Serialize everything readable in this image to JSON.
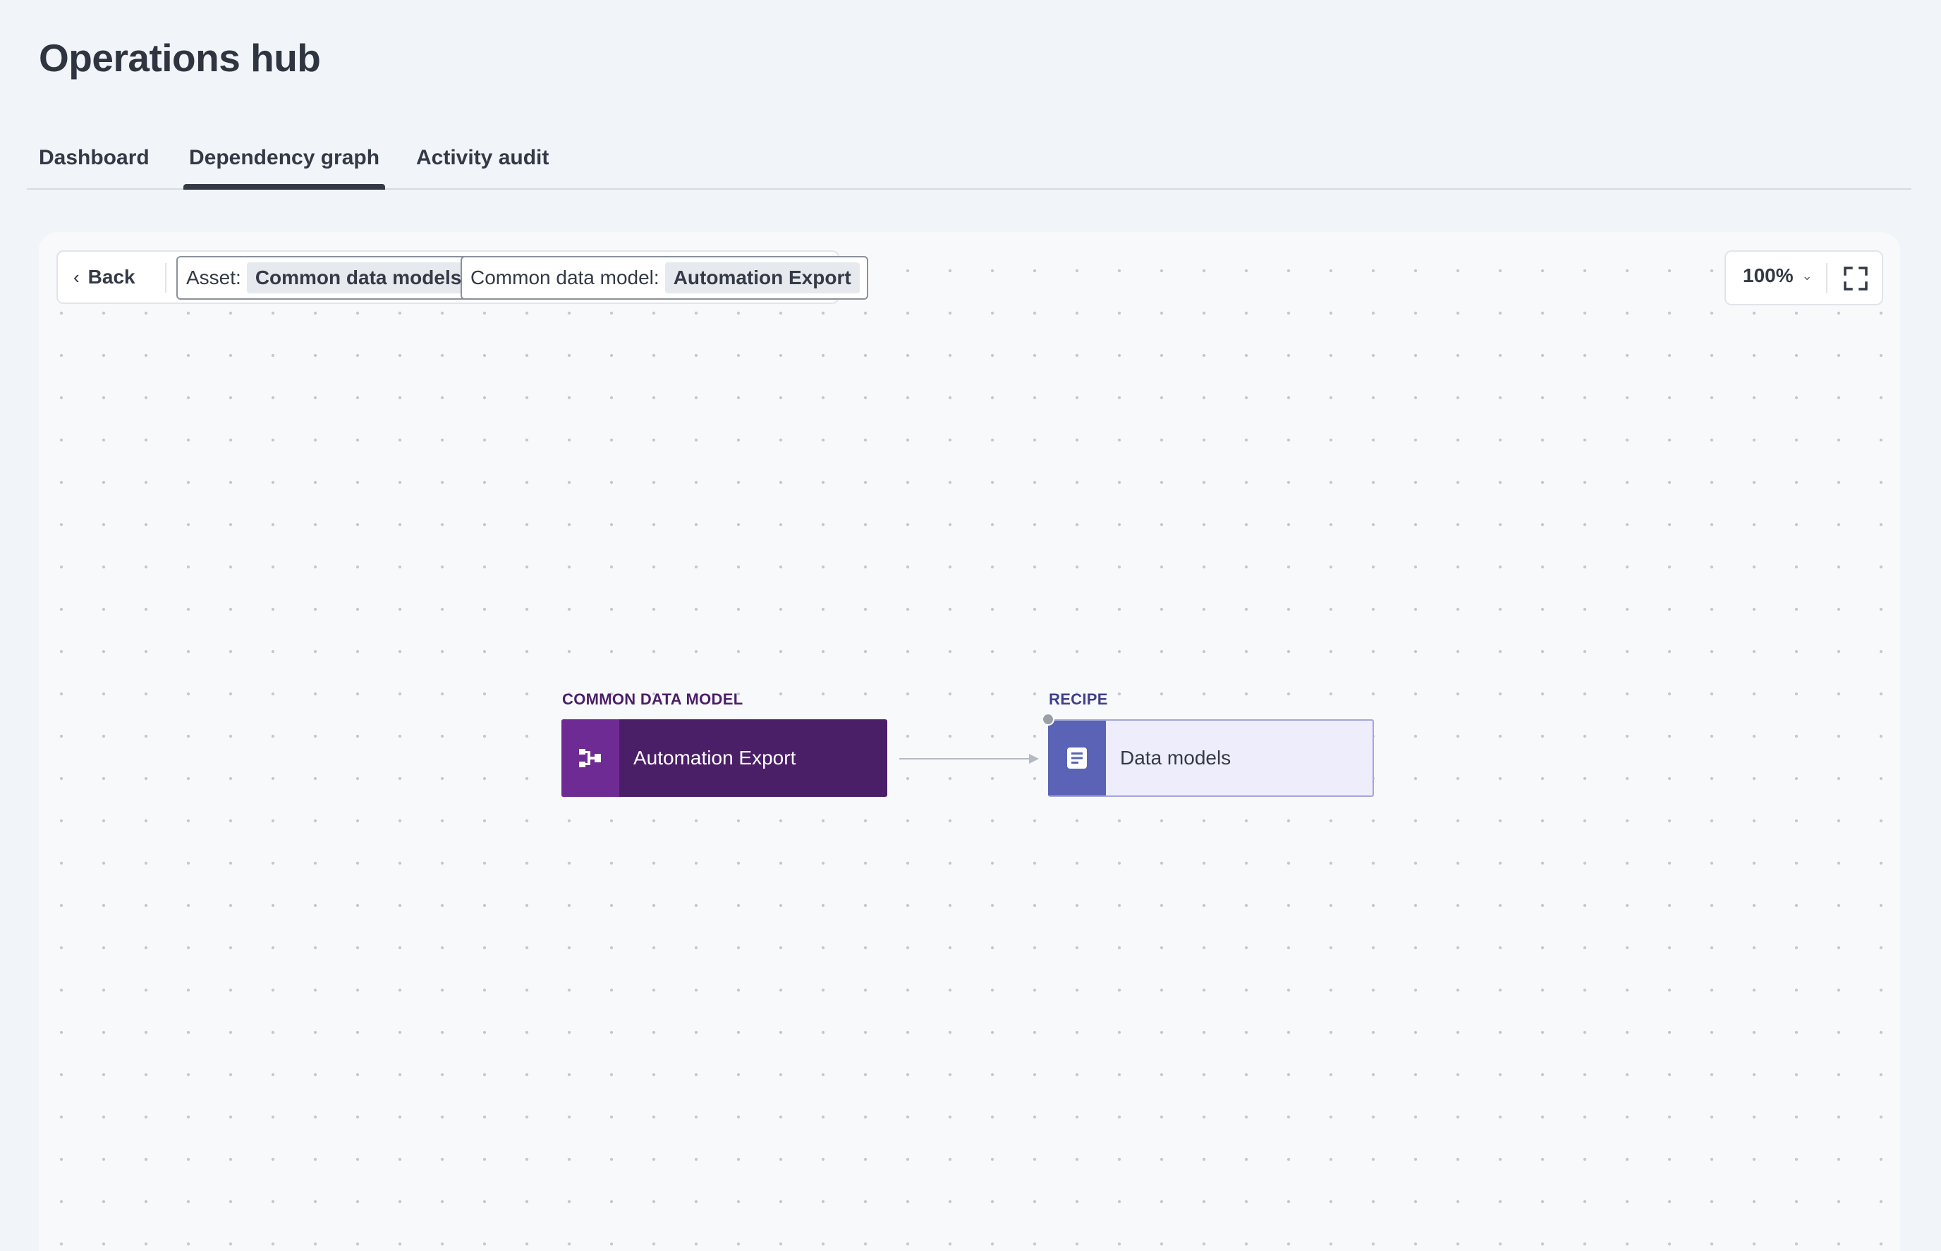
{
  "page": {
    "title": "Operations hub"
  },
  "tabs": [
    {
      "label": "Dashboard",
      "active": false
    },
    {
      "label": "Dependency graph",
      "active": true
    },
    {
      "label": "Activity audit",
      "active": false
    }
  ],
  "toolbar": {
    "back_label": "Back",
    "filters": [
      {
        "key": "Asset:",
        "value": "Common data models"
      },
      {
        "key": "Common data model:",
        "value": "Automation Export"
      }
    ],
    "zoom_value": "100%",
    "icons": {
      "back": "chevron-left-icon",
      "zoom_caret": "chevron-down-icon",
      "fullscreen": "fullscreen-icon"
    }
  },
  "graph": {
    "nodes": [
      {
        "type_label": "COMMON DATA MODEL",
        "label": "Automation Export",
        "icon": "data-model-icon",
        "colors": {
          "body": "#4b1f67",
          "icon_bg": "#6f2b94",
          "type_label": "#4b1f67"
        }
      },
      {
        "type_label": "RECIPE",
        "label": "Data models",
        "icon": "recipe-icon",
        "colors": {
          "body": "#eeedfb",
          "icon_bg": "#5a63b5",
          "border": "#a4a6da",
          "type_label": "#3f3f8a"
        }
      }
    ],
    "edges": [
      {
        "from": "Automation Export",
        "to": "Data models"
      }
    ]
  }
}
